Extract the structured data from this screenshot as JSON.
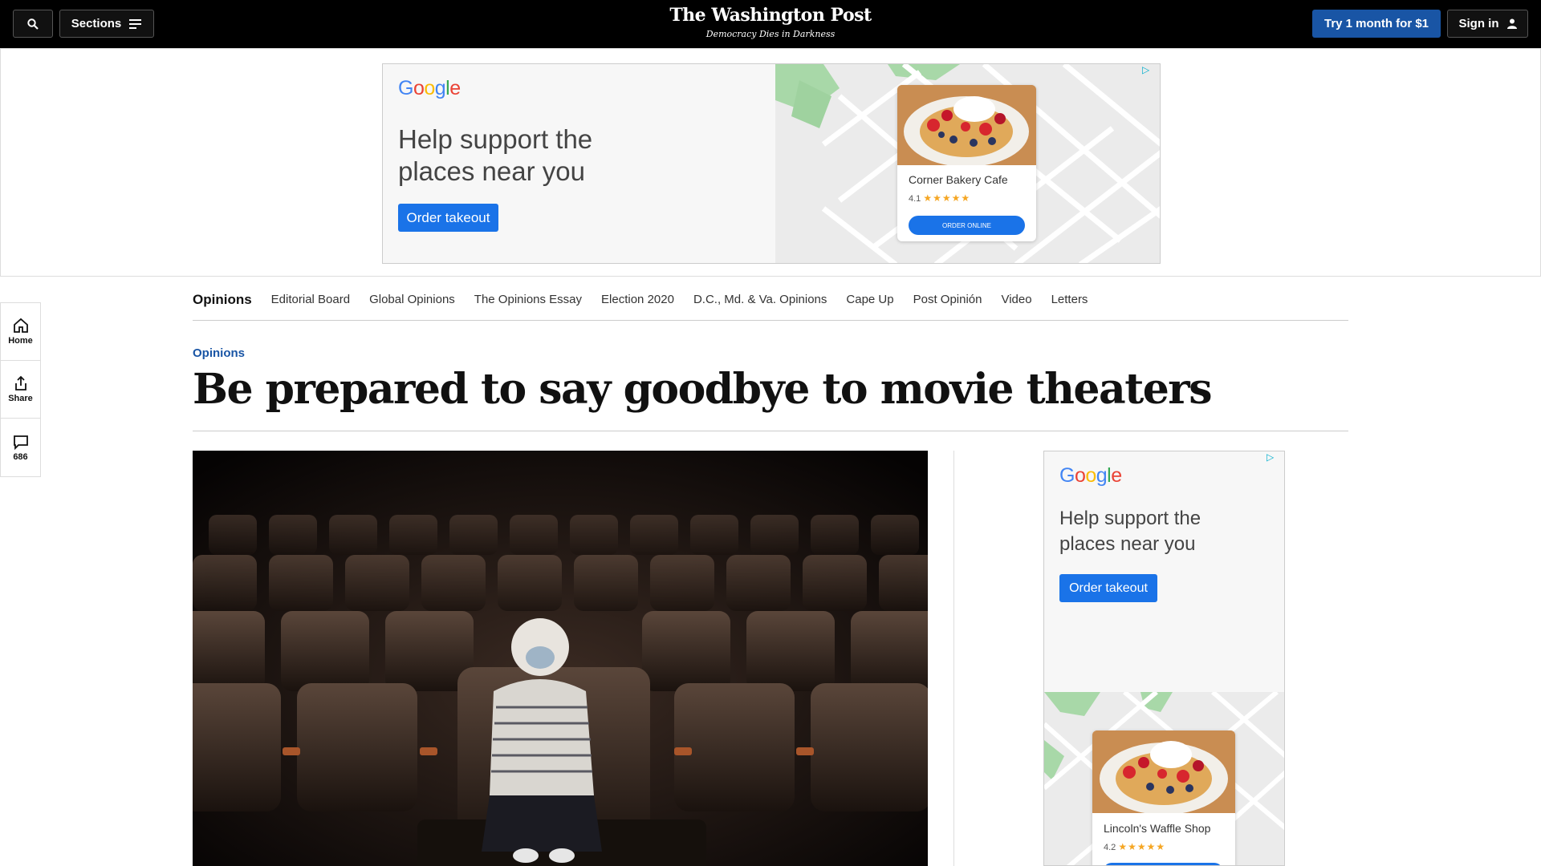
{
  "header": {
    "sections_label": "Sections",
    "logo_title": "The Washington Post",
    "logo_tagline": "Democracy Dies in Darkness",
    "subscribe_label": "Try 1 month for $1",
    "signin_label": "Sign in"
  },
  "top_ad": {
    "brand": [
      "G",
      "o",
      "o",
      "g",
      "l",
      "e"
    ],
    "headline_line1": "Help support the",
    "headline_line2": "places near you",
    "cta": "Order takeout",
    "place_name": "Corner Bakery Cafe",
    "rating": "4.1",
    "rating_stars": "★★★★★",
    "place_cta": "ORDER ONLINE"
  },
  "subnav": {
    "items": [
      "Opinions",
      "Editorial Board",
      "Global Opinions",
      "The Opinions Essay",
      "Election 2020",
      "D.C., Md. & Va. Opinions",
      "Cape Up",
      "Post Opinión",
      "Video",
      "Letters"
    ]
  },
  "rail": {
    "home_label": "Home",
    "share_label": "Share",
    "comments_count": "686"
  },
  "article": {
    "kicker": "Opinions",
    "headline": "Be prepared to say goodbye to movie theaters"
  },
  "side_ad": {
    "headline_line1": "Help support the",
    "headline_line2": "places near you",
    "cta": "Order takeout",
    "place_name": "Lincoln's Waffle Shop",
    "rating": "4.2",
    "rating_stars": "★★★★★"
  },
  "colors": {
    "brand_blue": "#1955a5",
    "ad_blue": "#1a73e8",
    "topbar_bg": "#000000"
  }
}
